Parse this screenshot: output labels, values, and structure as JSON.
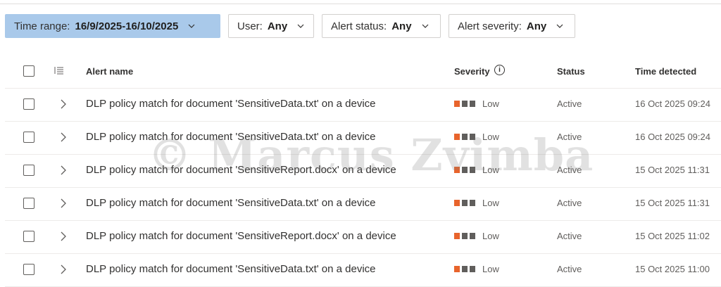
{
  "filters": [
    {
      "label": "Time range:",
      "value": "16/9/2025-16/10/2025",
      "active": true
    },
    {
      "label": "User:",
      "value": "Any",
      "active": false
    },
    {
      "label": "Alert status:",
      "value": "Any",
      "active": false
    },
    {
      "label": "Alert severity:",
      "value": "Any",
      "active": false
    }
  ],
  "table": {
    "columns": {
      "alert_name": "Alert name",
      "severity": "Severity",
      "status": "Status",
      "time_detected": "Time detected"
    },
    "rows": [
      {
        "name": "DLP policy match for document 'SensitiveData.txt' on a device",
        "severity": "Low",
        "status": "Active",
        "time": "16 Oct 2025 09:24"
      },
      {
        "name": "DLP policy match for document 'SensitiveData.txt' on a device",
        "severity": "Low",
        "status": "Active",
        "time": "16 Oct 2025 09:24"
      },
      {
        "name": "DLP policy match for document 'SensitiveReport.docx' on a device",
        "severity": "Low",
        "status": "Active",
        "time": "15 Oct 2025 11:31"
      },
      {
        "name": "DLP policy match for document 'SensitiveData.txt' on a device",
        "severity": "Low",
        "status": "Active",
        "time": "15 Oct 2025 11:31"
      },
      {
        "name": "DLP policy match for document 'SensitiveReport.docx' on a device",
        "severity": "Low",
        "status": "Active",
        "time": "15 Oct 2025 11:02"
      },
      {
        "name": "DLP policy match for document 'SensitiveData.txt' on a device",
        "severity": "Low",
        "status": "Active",
        "time": "15 Oct 2025 11:00"
      }
    ]
  },
  "severity_colors": {
    "low_active": "#e8642c",
    "inactive": "#605e5c"
  },
  "accent_color": "#a9c9ea",
  "watermark": "© Marcus Zvimba"
}
